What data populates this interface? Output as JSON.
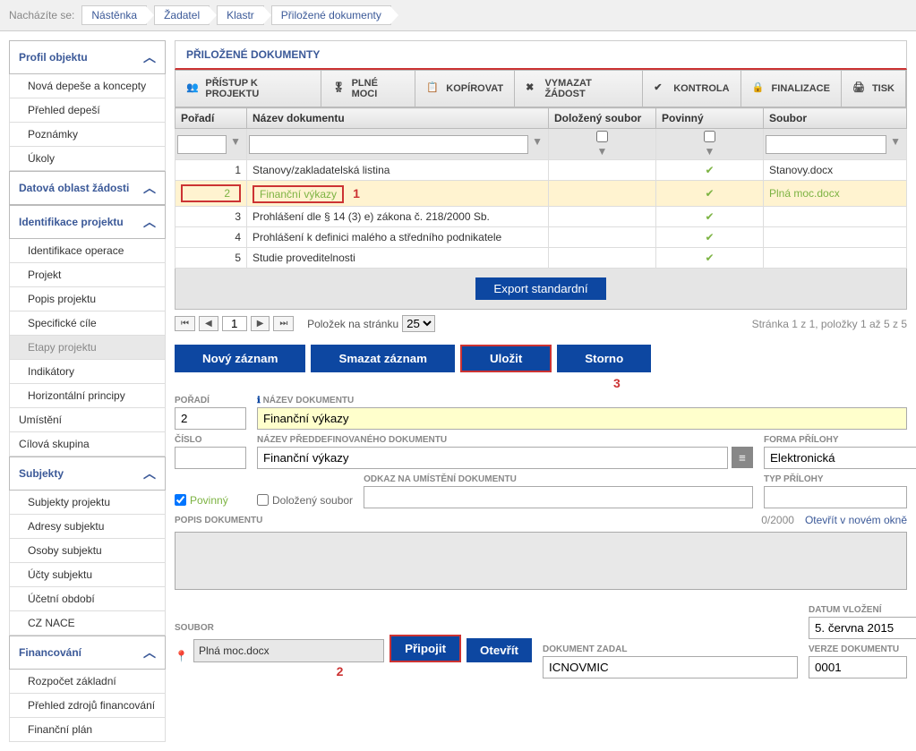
{
  "breadcrumb": {
    "label": "Nacházíte se:",
    "items": [
      "Nástěnka",
      "Žadatel",
      "Klastr",
      "Přiložené dokumenty"
    ]
  },
  "sidebar": {
    "groups": [
      {
        "title": "Profil objektu",
        "items": [
          "Nová depeše a koncepty",
          "Přehled depeší",
          "Poznámky",
          "Úkoly"
        ]
      },
      {
        "title": "Datová oblast žádosti",
        "items": []
      },
      {
        "title": "Identifikace projektu",
        "items": [
          "Identifikace operace",
          "Projekt",
          "Popis projektu",
          "Specifické cíle",
          "Etapy projektu",
          "Indikátory",
          "Horizontální principy"
        ],
        "active": "Etapy projektu"
      }
    ],
    "flat_after": [
      "Umístění",
      "Cílová skupina"
    ],
    "group_subjekty": {
      "title": "Subjekty",
      "items": [
        "Subjekty projektu",
        "Adresy subjektu",
        "Osoby subjektu",
        "Účty subjektu",
        "Účetní období",
        "CZ NACE"
      ]
    },
    "group_financovani": {
      "title": "Financování",
      "items": [
        "Rozpočet základní",
        "Přehled zdrojů financování",
        "Finanční plán"
      ]
    }
  },
  "content": {
    "title": "PŘILOŽENÉ DOKUMENTY",
    "toolbar": [
      "PŘÍSTUP K PROJEKTU",
      "PLNÉ MOCI",
      "KOPÍROVAT",
      "VYMAZAT ŽÁDOST",
      "KONTROLA",
      "FINALIZACE",
      "TISK"
    ],
    "icons": [
      "people-icon",
      "badge-icon",
      "copy-icon",
      "delete-icon",
      "check-icon",
      "lock-icon",
      "print-icon"
    ]
  },
  "table": {
    "headers": [
      "Pořadí",
      "Název dokumentu",
      "Doložený soubor",
      "Povinný",
      "Soubor"
    ],
    "rows": [
      {
        "n": "1",
        "name": "Stanovy/zakladatelská listina",
        "req": true,
        "file": "Stanovy.docx"
      },
      {
        "n": "2",
        "name": "Finanční výkazy",
        "req": true,
        "file": "Plná moc.docx",
        "selected": true
      },
      {
        "n": "3",
        "name": "Prohlášení dle § 14 (3) e) zákona č. 218/2000 Sb.",
        "req": true,
        "file": ""
      },
      {
        "n": "4",
        "name": "Prohlášení k definici malého a středního podnikatele",
        "req": true,
        "file": ""
      },
      {
        "n": "5",
        "name": "Studie proveditelnosti",
        "req": true,
        "file": ""
      }
    ],
    "export": "Export standardní",
    "marker1": "1"
  },
  "pager": {
    "page": "1",
    "perpage_label": "Položek na stránku",
    "perpage": "25",
    "info": "Stránka 1 z 1, položky 1 až 5 z 5"
  },
  "actions": {
    "new": "Nový záznam",
    "delete": "Smazat záznam",
    "save": "Uložit",
    "cancel": "Storno",
    "marker3": "3"
  },
  "form": {
    "poradi_label": "POŘADÍ",
    "poradi": "2",
    "nazev_label": "NÁZEV DOKUMENTU",
    "nazev": "Finanční výkazy",
    "cislo_label": "ČÍSLO",
    "cislo": "",
    "predef_label": "NÁZEV PŘEDDEFINOVANÉHO DOKUMENTU",
    "predef": "Finanční výkazy",
    "forma_label": "FORMA PŘÍLOHY",
    "forma": "Elektronická",
    "povinny": "Povinný",
    "dolozeny": "Doložený soubor",
    "odkaz_label": "ODKAZ NA UMÍSTĚNÍ DOKUMENTU",
    "odkaz": "",
    "typ_label": "TYP PŘÍLOHY",
    "typ": "",
    "popis_label": "POPIS DOKUMENTU",
    "popis_count": "0/2000",
    "popis_open": "Otevřít v novém okně",
    "soubor_label": "SOUBOR",
    "soubor": "Plná moc.docx",
    "pripojit": "Připojit",
    "otevrit": "Otevřít",
    "marker2": "2",
    "zadal_label": "DOKUMENT ZADAL",
    "zadal": "ICNOVMIC",
    "datum_label": "DATUM VLOŽENÍ",
    "datum": "5. června 2015",
    "verze_label": "VERZE DOKUMENTU",
    "verze": "0001"
  }
}
